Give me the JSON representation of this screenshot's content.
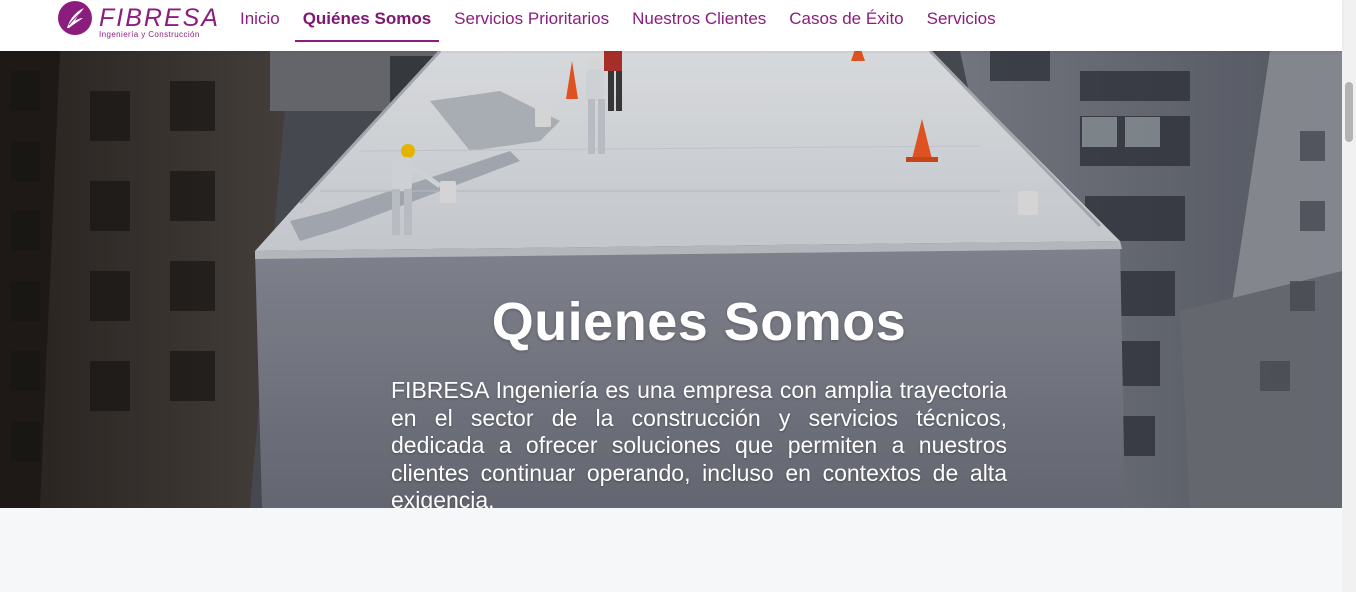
{
  "brand": {
    "name": "FIBRESA",
    "tagline": "Ingeniería y Construcción",
    "color": "#8b1d7f"
  },
  "nav": {
    "items": [
      {
        "label": "Inicio",
        "active": false
      },
      {
        "label": "Quiénes Somos",
        "active": true
      },
      {
        "label": "Servicios Prioritarios",
        "active": false
      },
      {
        "label": "Nuestros Clientes",
        "active": false
      },
      {
        "label": "Casos de Éxito",
        "active": false
      },
      {
        "label": "Servicios",
        "active": false
      }
    ]
  },
  "hero": {
    "title": "Quienes Somos",
    "text": "FIBRESA Ingeniería es una empresa con amplia trayectoria en el sector de la construcción y servicios técnicos, dedicada a ofrecer soluciones que permiten a nuestros clientes continuar operando, incluso en contextos de alta exigencia."
  },
  "icons": {
    "logo": "feather-logo-icon"
  }
}
